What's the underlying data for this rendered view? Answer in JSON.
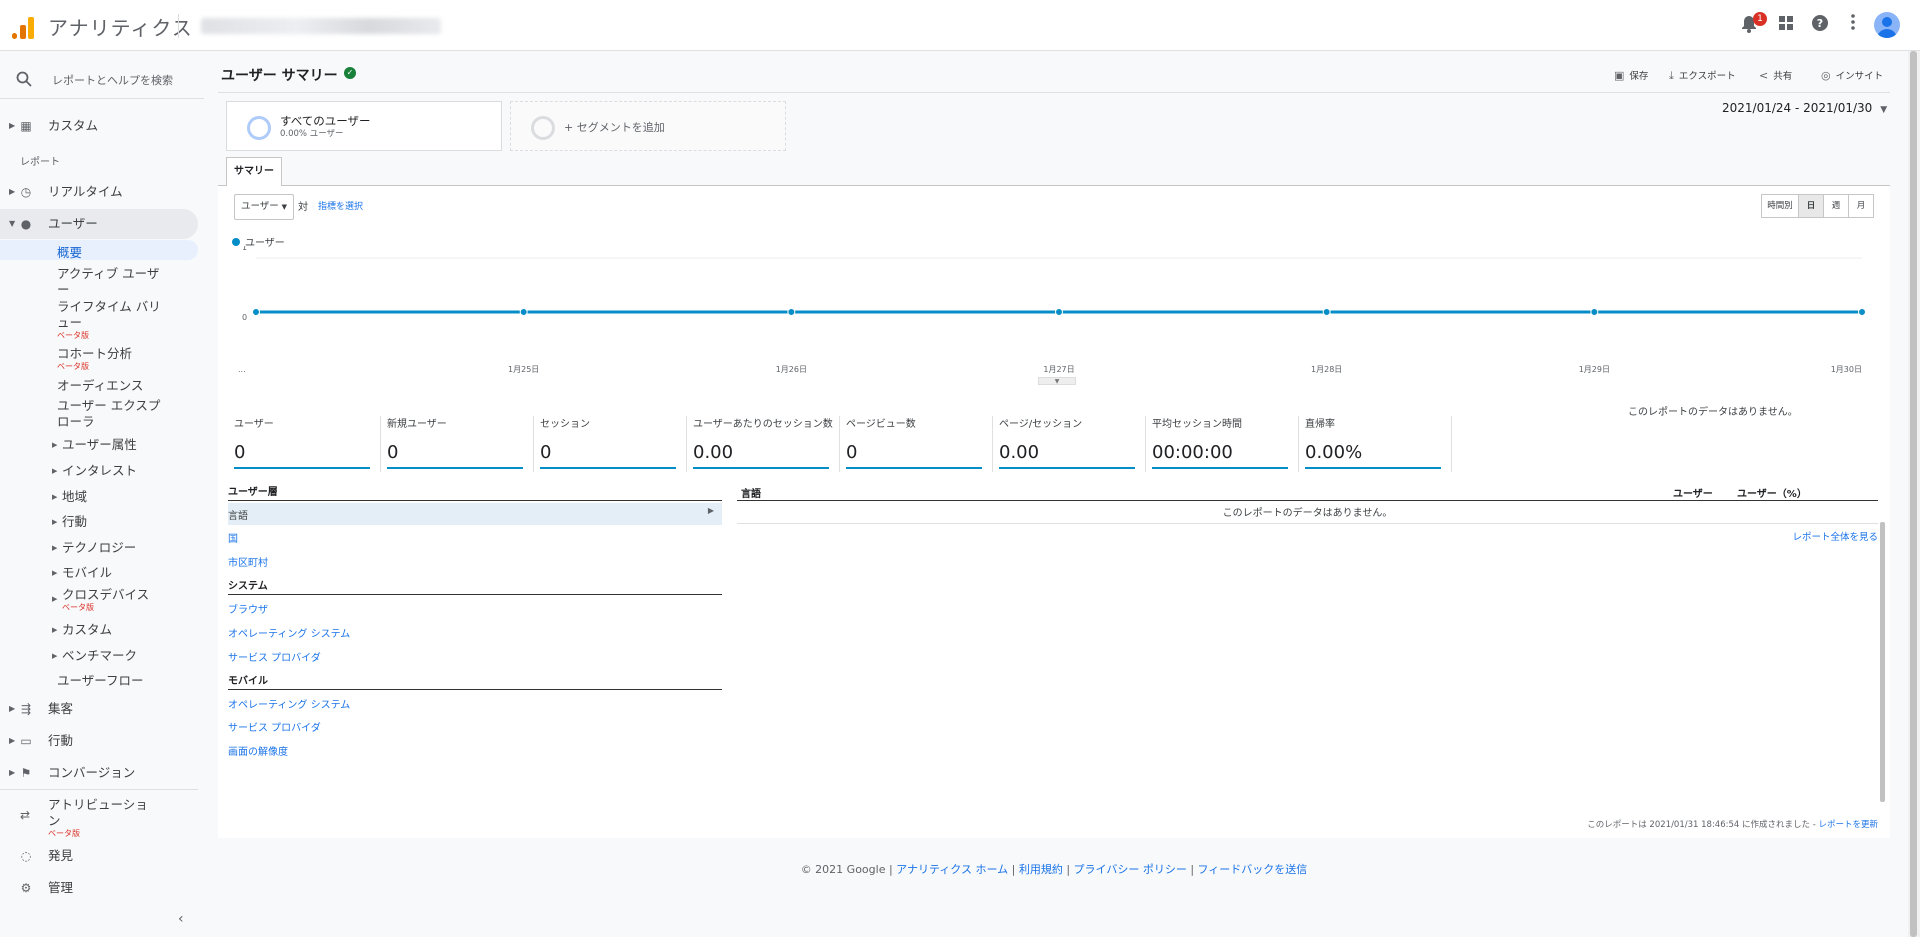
{
  "app": {
    "title": "アナリティクス"
  },
  "colors": {
    "accent": "#1a73e8",
    "chart_line": "#058dc7",
    "logo_orange": "#f9ab00",
    "logo_dark": "#e37400"
  },
  "topbar": {
    "notification_count": "1",
    "icons": [
      "bell-icon",
      "apps-icon",
      "help-icon",
      "more-vert-icon",
      "account-avatar"
    ]
  },
  "sidebar": {
    "search_placeholder": "レポートとヘルプを検索",
    "custom": "カスタム",
    "section_reports": "レポート",
    "realtime": "リアルタイム",
    "audience": "ユーザー",
    "audience_items": {
      "overview": "概要",
      "active_users_1": "アクティブ ユーザ",
      "active_users_2": "ー",
      "lifetime_1": "ライフタイム バリ",
      "lifetime_2": "ュー",
      "lifetime_beta": "ベータ版",
      "cohort": "コホート分析",
      "cohort_beta": "ベータ版",
      "audiences": "オーディエンス",
      "explorer_1": "ユーザー エクスプ",
      "explorer_2": "ローラ",
      "demographics": "ユーザー属性",
      "interests": "インタレスト",
      "geo": "地域",
      "behavior": "行動",
      "technology": "テクノロジー",
      "mobile": "モバイル",
      "cross_device": "クロスデバイス",
      "cross_device_beta": "ベータ版",
      "custom": "カスタム",
      "benchmark": "ベンチマーク",
      "users_flow": "ユーザーフロー"
    },
    "acquisition": "集客",
    "behavior": "行動",
    "conversions": "コンバージョン",
    "attribution_1": "アトリビューショ",
    "attribution_2": "ン",
    "attribution_beta": "ベータ版",
    "discover": "発見",
    "admin": "管理"
  },
  "header": {
    "title": "ユーザー サマリー",
    "save": "保存",
    "export": "エクスポート",
    "share": "共有",
    "insights": "インサイト"
  },
  "segments": [
    {
      "title": "すべてのユーザー",
      "subtitle": "0.00% ユーザー"
    },
    {
      "title": "+ セグメントを追加"
    }
  ],
  "date_range": "2021/01/24 - 2021/01/30",
  "tab": "サマリー",
  "controls": {
    "metric": "ユーザー",
    "vs": "対",
    "select_metric": "指標を選択",
    "granularity": [
      "時間別",
      "日",
      "週",
      "月"
    ]
  },
  "chart_data": {
    "type": "line",
    "series": [
      {
        "name": "ユーザー",
        "values": [
          0,
          0,
          0,
          0,
          0,
          0,
          0
        ]
      }
    ],
    "x": [
      "...",
      "1月25日",
      "1月26日",
      "1月27日",
      "1月28日",
      "1月29日",
      "1月30日"
    ],
    "yticks": [
      "1",
      "0"
    ],
    "ylim": [
      0,
      1
    ],
    "grid": true
  },
  "no_data": "このレポートのデータはありません。",
  "stats": [
    {
      "label": "ユーザー",
      "value": "0"
    },
    {
      "label": "新規ユーザー",
      "value": "0"
    },
    {
      "label": "セッション",
      "value": "0"
    },
    {
      "label": "ユーザーあたりのセッション数",
      "value": "0.00"
    },
    {
      "label": "ページビュー数",
      "value": "0"
    },
    {
      "label": "ページ/セッション",
      "value": "0.00"
    },
    {
      "label": "平均セッション時間",
      "value": "00:00:00"
    },
    {
      "label": "直帰率",
      "value": "0.00%"
    }
  ],
  "dimensions": {
    "group1": "ユーザー層",
    "selected": "言語",
    "country": "国",
    "city": "市区町村",
    "group2": "システム",
    "browser": "ブラウザ",
    "os": "オペレーティング システム",
    "isp": "サービス プロバイダ",
    "group3": "モバイル",
    "mobile_os": "オペレーティング システム",
    "mobile_isp": "サービス プロバイダ",
    "resolution": "画面の解像度"
  },
  "table": {
    "col_dim": "言語",
    "col_users": "ユーザー",
    "col_users_pct": "ユーザー（%）",
    "no_data": "このレポートのデータはありません。",
    "view_full": "レポート全体を見る"
  },
  "generated_note": "このレポートは 2021/01/31 18:46:54 に作成されました - ",
  "refresh_link": "レポートを更新",
  "footer": {
    "copyright": "© 2021 Google | ",
    "home": "アナリティクス ホーム",
    "sep": " | ",
    "terms": "利用規約",
    "privacy": "プライバシー ポリシー",
    "feedback": "フィードバックを送信"
  }
}
